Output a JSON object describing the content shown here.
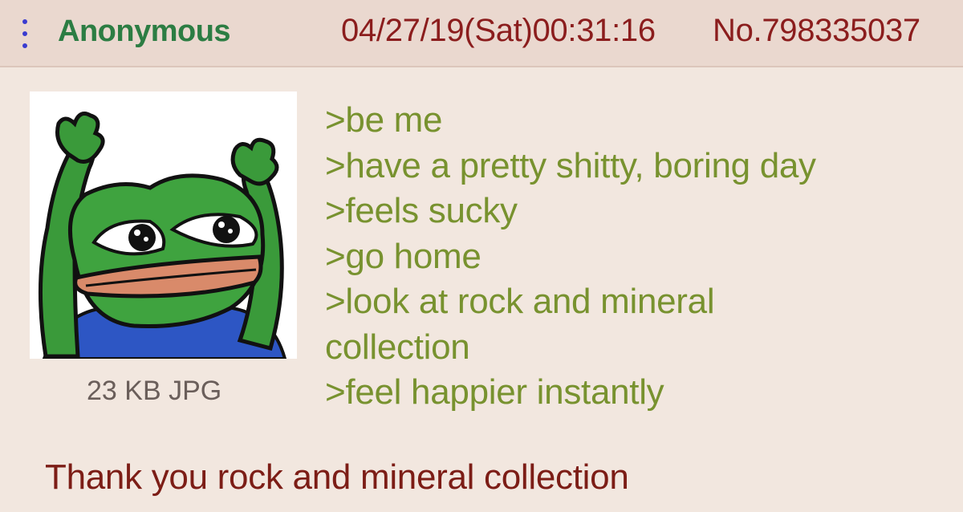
{
  "post": {
    "name": "Anonymous",
    "datetime": "04/27/19(Sat)00:31:16",
    "post_number": "No.798335037",
    "file": {
      "info": "23 KB JPG",
      "thumbnail": "pepe-frog-arms-raised"
    },
    "greentext": [
      ">be me",
      ">have a pretty shitty, boring day",
      ">feels sucky",
      ">go home",
      ">look at rock and mineral",
      "collection",
      ">feel happier instantly"
    ],
    "comment": "Thank you rock and mineral collection"
  },
  "colors": {
    "background": "#f2e7df",
    "header": "#ead8cf",
    "name": "#2c7d43",
    "greentext": "#78922f",
    "maroon": "#7c1d16",
    "menu_dots": "#3a3bd0"
  },
  "icons": {
    "menu": "vertical-dots-icon"
  }
}
